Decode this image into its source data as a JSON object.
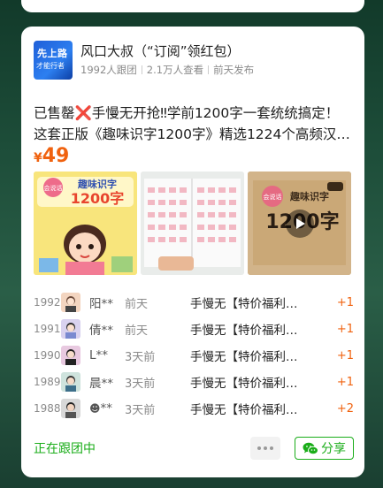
{
  "account": {
    "name": "风口大叔（“订阅”领红包）",
    "avatar_text_1": "先上路",
    "avatar_text_2": "才能行者",
    "followers": "1992人跟团",
    "views": "2.1万人查看",
    "published": "前天发布"
  },
  "product": {
    "desc_line1": "已售罄❌手慢无开抢‼学前1200字一套统统搞定！",
    "desc_line2": "这套正版《趣味识字1200字》精选1224个高频汉…",
    "price_symbol": "¥",
    "price_value": "49",
    "images": [
      {
        "title": "趣味识字",
        "big": "1200字",
        "badge": "会说话"
      },
      {
        "title": "",
        "big": "",
        "badge": ""
      },
      {
        "title": "趣味识字",
        "big": "1200字",
        "badge": "会说话"
      }
    ]
  },
  "orders": [
    {
      "num": "1992",
      "name": "阳**",
      "time": "前天",
      "product": "手慢无【特价福利…",
      "count": "+1",
      "avatar_color": "#f3d5c0"
    },
    {
      "num": "1991",
      "name": "倩**",
      "time": "前天",
      "product": "手慢无【特价福利…",
      "count": "+1",
      "avatar_color": "#d9d2ef"
    },
    {
      "num": "1990",
      "name": "L**",
      "time": "3天前",
      "product": "手慢无【特价福利…",
      "count": "+1",
      "avatar_color": "#e8c9e0"
    },
    {
      "num": "1989",
      "name": "晨**",
      "time": "3天前",
      "product": "手慢无【特价福利…",
      "count": "+1",
      "avatar_color": "#cfe3dd"
    },
    {
      "num": "1988",
      "name": "**",
      "time": "3天前",
      "product": "手慢无【特价福利…",
      "count": "+2",
      "avatar_color": "#d8d8d8"
    }
  ],
  "footer": {
    "status": "正在跟团中",
    "share_label": "分享"
  },
  "colors": {
    "accent_green": "#1aad19",
    "price_orange": "#f0620f"
  }
}
